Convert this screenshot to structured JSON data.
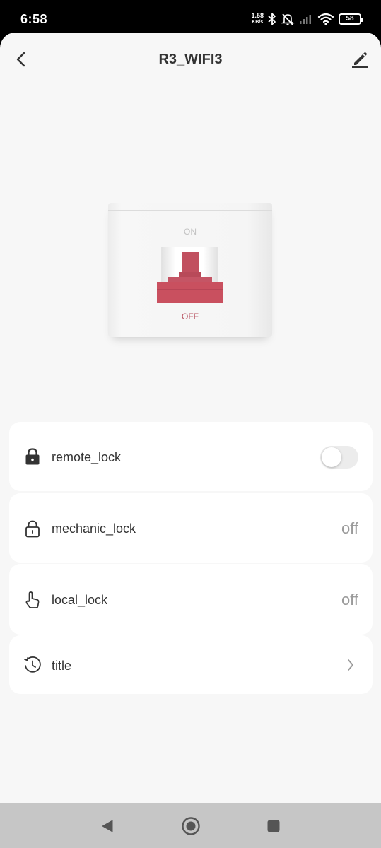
{
  "status_bar": {
    "time": "6:58",
    "net_speed_value": "1.58",
    "net_speed_unit": "KB/s",
    "battery": "58",
    "icons": [
      "bluetooth-icon",
      "mute-icon",
      "signal-icon",
      "wifi-icon",
      "battery-icon"
    ]
  },
  "header": {
    "title": "R3_WIFI3",
    "back_icon": "chevron-left-icon",
    "edit_icon": "pencil-icon"
  },
  "switch": {
    "on_label": "ON",
    "off_label": "OFF",
    "state": "off",
    "accent_color": "#c9505f"
  },
  "rows": [
    {
      "icon": "lock-closed-icon",
      "label": "remote_lock",
      "control": "toggle",
      "toggle_on": false
    },
    {
      "icon": "lock-open-icon",
      "label": "mechanic_lock",
      "value": "off"
    },
    {
      "icon": "hand-pointer-icon",
      "label": "local_lock",
      "value": "off"
    },
    {
      "icon": "clock-history-icon",
      "label": "title",
      "control": "chevron"
    }
  ],
  "nav": {
    "back": "triangle-back-icon",
    "home": "circle-home-icon",
    "recents": "square-recents-icon"
  }
}
